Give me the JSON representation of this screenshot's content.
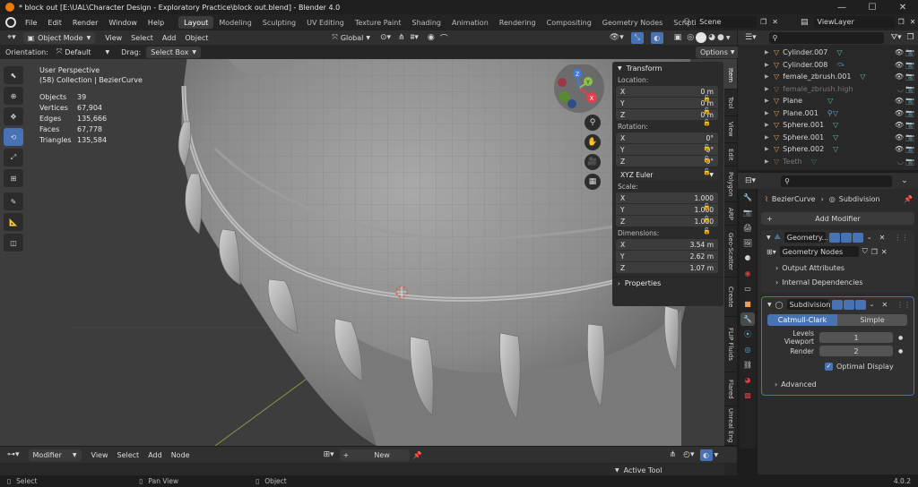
{
  "window": {
    "title": "* block out [E:\\UAL\\Character Design - Exploratory Practice\\block out.blend] - Blender 4.0",
    "minimize": "—",
    "maximize": "☐",
    "close": "✕"
  },
  "menubar": {
    "items": [
      "File",
      "Edit",
      "Render",
      "Window",
      "Help"
    ],
    "workspaces": [
      "Layout",
      "Modeling",
      "Sculpting",
      "UV Editing",
      "Texture Paint",
      "Shading",
      "Animation",
      "Rendering",
      "Compositing",
      "Geometry Nodes",
      "Scripting"
    ],
    "active_workspace": "Layout",
    "add_tab": "+",
    "scene": "Scene",
    "view_layer": "ViewLayer"
  },
  "viewport_header": {
    "mode": "Object Mode",
    "menus": [
      "View",
      "Select",
      "Add",
      "Object"
    ],
    "transform_orientation": "Global",
    "options": "Options",
    "orientation_label": "Orientation:",
    "orientation_value": "Default",
    "drag_label": "Drag:",
    "drag_value": "Select Box"
  },
  "viewport_overlay": {
    "perspective": "User Perspective",
    "collection": "(58) Collection | BezierCurve",
    "stats": [
      {
        "label": "Objects",
        "value": "39"
      },
      {
        "label": "Vertices",
        "value": "67,904"
      },
      {
        "label": "Edges",
        "value": "135,666"
      },
      {
        "label": "Faces",
        "value": "67,778"
      },
      {
        "label": "Triangles",
        "value": "135,584"
      }
    ],
    "gizmo_axes": {
      "x": "X",
      "y": "Y",
      "z": "Z"
    }
  },
  "transform_panel": {
    "title": "Transform",
    "location_label": "Location:",
    "location": [
      {
        "axis": "X",
        "value": "0 m"
      },
      {
        "axis": "Y",
        "value": "0 m"
      },
      {
        "axis": "Z",
        "value": "0 m"
      }
    ],
    "rotation_label": "Rotation:",
    "rotation": [
      {
        "axis": "X",
        "value": "0°"
      },
      {
        "axis": "Y",
        "value": "0°"
      },
      {
        "axis": "Z",
        "value": "0°"
      }
    ],
    "rotation_mode": "XYZ Euler",
    "scale_label": "Scale:",
    "scale": [
      {
        "axis": "X",
        "value": "1.000"
      },
      {
        "axis": "Y",
        "value": "1.000"
      },
      {
        "axis": "Z",
        "value": "1.000"
      }
    ],
    "dimensions_label": "Dimensions:",
    "dimensions": [
      {
        "axis": "X",
        "value": "3.54 m"
      },
      {
        "axis": "Y",
        "value": "2.62 m"
      },
      {
        "axis": "Z",
        "value": "1.07 m"
      }
    ],
    "properties_label": "Properties"
  },
  "sidebar_tabs": [
    "Item",
    "Tool",
    "View",
    "Edit",
    "Polygon",
    "ARP",
    "Geo-Scatter",
    "Create",
    "FLIP Fluids",
    "Flared",
    "Unreal Eng"
  ],
  "outliner": {
    "items": [
      {
        "name": "Cylinder.007",
        "dim": false
      },
      {
        "name": "Cylinder.008",
        "dim": false
      },
      {
        "name": "female_zbrush.001",
        "dim": false
      },
      {
        "name": "female_zbrush.high",
        "dim": true
      },
      {
        "name": "Plane",
        "dim": false
      },
      {
        "name": "Plane.001",
        "dim": false
      },
      {
        "name": "Sphere.001",
        "dim": false
      },
      {
        "name": "Sphere.001",
        "dim": false
      },
      {
        "name": "Sphere.002",
        "dim": false
      },
      {
        "name": "Teeth",
        "dim": true
      }
    ]
  },
  "properties": {
    "object_name": "BezierCurve",
    "modifier_name": "Subdivision",
    "add_modifier": "Add Modifier",
    "geometry_modifier": "Geometry...",
    "node_group": "Geometry Nodes",
    "output_attributes": "Output Attributes",
    "internal_dependencies": "Internal Dependencies",
    "subdivision_name": "Subdivision",
    "catmull_clark": "Catmull-Clark",
    "simple": "Simple",
    "levels_viewport_label": "Levels Viewport",
    "levels_viewport_value": "1",
    "render_label": "Render",
    "render_value": "2",
    "optimal_display": "Optimal Display",
    "advanced": "Advanced",
    "active_tool": "Active Tool"
  },
  "bottom_editor": {
    "mode": "Modifier",
    "menus": [
      "View",
      "Select",
      "Add",
      "Node"
    ],
    "new_button": "New"
  },
  "statusbar": {
    "select": "Select",
    "pan_view": "Pan View",
    "object": "Object",
    "version": "4.0.2"
  },
  "colors": {
    "accent": "#4772b3",
    "x_axis": "#e0404f",
    "y_axis": "#8bc34a",
    "z_axis": "#3d7ae0",
    "mesh_icon": "#e8a25a",
    "modifier_icon": "#5fa8d3"
  }
}
